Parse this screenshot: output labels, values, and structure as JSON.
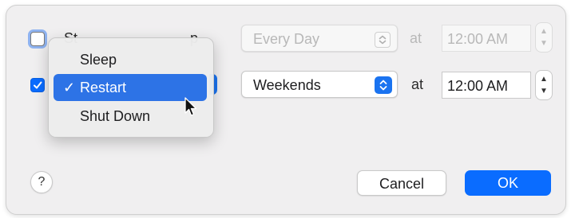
{
  "row1": {
    "label_partial": "St",
    "label_partial_end": "p",
    "frequency": "Every Day",
    "at_label": "at",
    "time": "12:00 AM"
  },
  "row2": {
    "frequency": "Weekends",
    "at_label": "at",
    "time": "12:00 AM"
  },
  "menu": {
    "items": [
      {
        "label": "Sleep"
      },
      {
        "label": "Restart",
        "checkmark": "✓"
      },
      {
        "label": "Shut Down"
      }
    ]
  },
  "buttons": {
    "help_label": "?",
    "cancel_label": "Cancel",
    "ok_label": "OK"
  },
  "colors": {
    "accent": "#0a6cff",
    "menu_highlight": "#2d73e6"
  },
  "icons": {
    "checkbox_checked": "checkmark-icon",
    "popup_chevrons": "up-down-chevron-icon",
    "cursor": "arrow-cursor-icon"
  }
}
